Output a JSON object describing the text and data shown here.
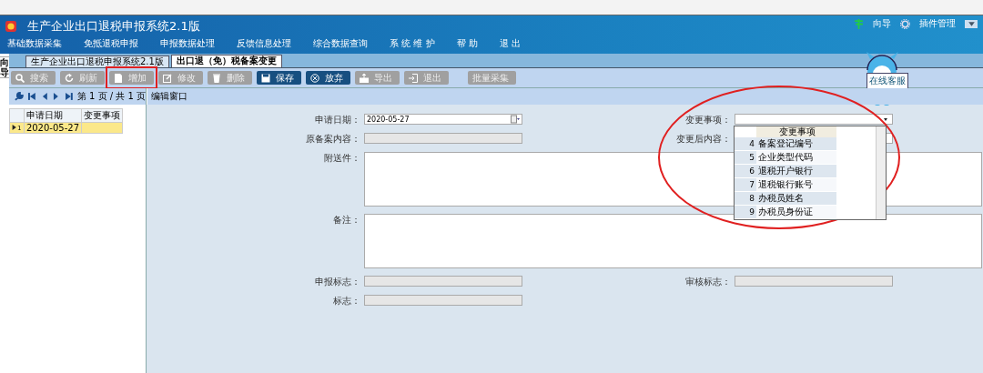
{
  "window": {
    "title": "生产企业出口退税申报系统2.1版"
  },
  "menu": [
    "基础数据采集",
    "免抵退税申报",
    "申报数据处理",
    "反馈信息处理",
    "综合数据查询",
    "系 统 维 护",
    "帮 助",
    "退 出"
  ],
  "header_links": [
    {
      "kind": "guide",
      "label": "向导"
    },
    {
      "kind": "plugin",
      "label": "插件管理"
    }
  ],
  "mascot": {
    "badge": "在线客服"
  },
  "side_tab": {
    "label": "向导"
  },
  "tabs": [
    {
      "label": "生产企业出口退税申报系统2.1版",
      "selected": false
    },
    {
      "label": "出口退（免）税备案变更",
      "selected": true
    }
  ],
  "toolbar": [
    {
      "kind": "search",
      "label": "搜索",
      "enabled": false,
      "highlighted": false
    },
    {
      "kind": "refresh",
      "label": "刷新",
      "enabled": false,
      "highlighted": false
    },
    {
      "kind": "add",
      "label": "增加",
      "enabled": false,
      "highlighted": true
    },
    {
      "kind": "edit",
      "label": "修改",
      "enabled": false,
      "highlighted": false
    },
    {
      "kind": "delete",
      "label": "删除",
      "enabled": false,
      "highlighted": false
    },
    {
      "kind": "save",
      "label": "保存",
      "enabled": true,
      "highlighted": false
    },
    {
      "kind": "discard",
      "label": "放弃",
      "enabled": true,
      "highlighted": false
    },
    {
      "kind": "export",
      "label": "导出",
      "enabled": false,
      "highlighted": false
    },
    {
      "kind": "exit",
      "label": "退出",
      "enabled": false,
      "highlighted": false
    },
    {
      "kind": "batch",
      "label": "批量采集",
      "enabled": false,
      "highlighted": false
    }
  ],
  "pager": {
    "text": "第 1 页 / 共 1 页"
  },
  "grid": {
    "columns": [
      "申请日期",
      "变更事项"
    ],
    "rows": [
      {
        "index": "1",
        "cells": [
          "2020-05-27",
          ""
        ],
        "selected": true
      }
    ]
  },
  "editor": {
    "title": "编辑窗口",
    "rows": [
      {
        "fields": [
          {
            "kind": "date",
            "label": "申请日期：",
            "value": "2020-05-27"
          },
          {
            "kind": "combo",
            "label": "变更事项："
          }
        ]
      },
      {
        "fields": [
          {
            "kind": "readonly",
            "label": "原备案内容："
          },
          {
            "kind": "text",
            "label": "变更后内容："
          }
        ]
      },
      {
        "fields": [
          {
            "kind": "textarea",
            "label": "附送件："
          }
        ]
      },
      {
        "fields": [
          {
            "kind": "textarea",
            "label": "备注："
          }
        ]
      },
      {
        "fields": [
          {
            "kind": "readonly",
            "label": "申报标志："
          },
          {
            "kind": "readonly",
            "label": "审核标志："
          }
        ]
      },
      {
        "fields": [
          {
            "kind": "readonly",
            "label": "标志："
          }
        ]
      }
    ]
  },
  "dropdown": {
    "header": "变更事项",
    "highlighted": true,
    "rows": [
      {
        "index": "4",
        "label": "备案登记编号"
      },
      {
        "index": "5",
        "label": "企业类型代码"
      },
      {
        "index": "6",
        "label": "退税开户银行"
      },
      {
        "index": "7",
        "label": "退税银行账号"
      },
      {
        "index": "8",
        "label": "办税员姓名"
      },
      {
        "index": "9",
        "label": "办税员身份证"
      }
    ]
  }
}
